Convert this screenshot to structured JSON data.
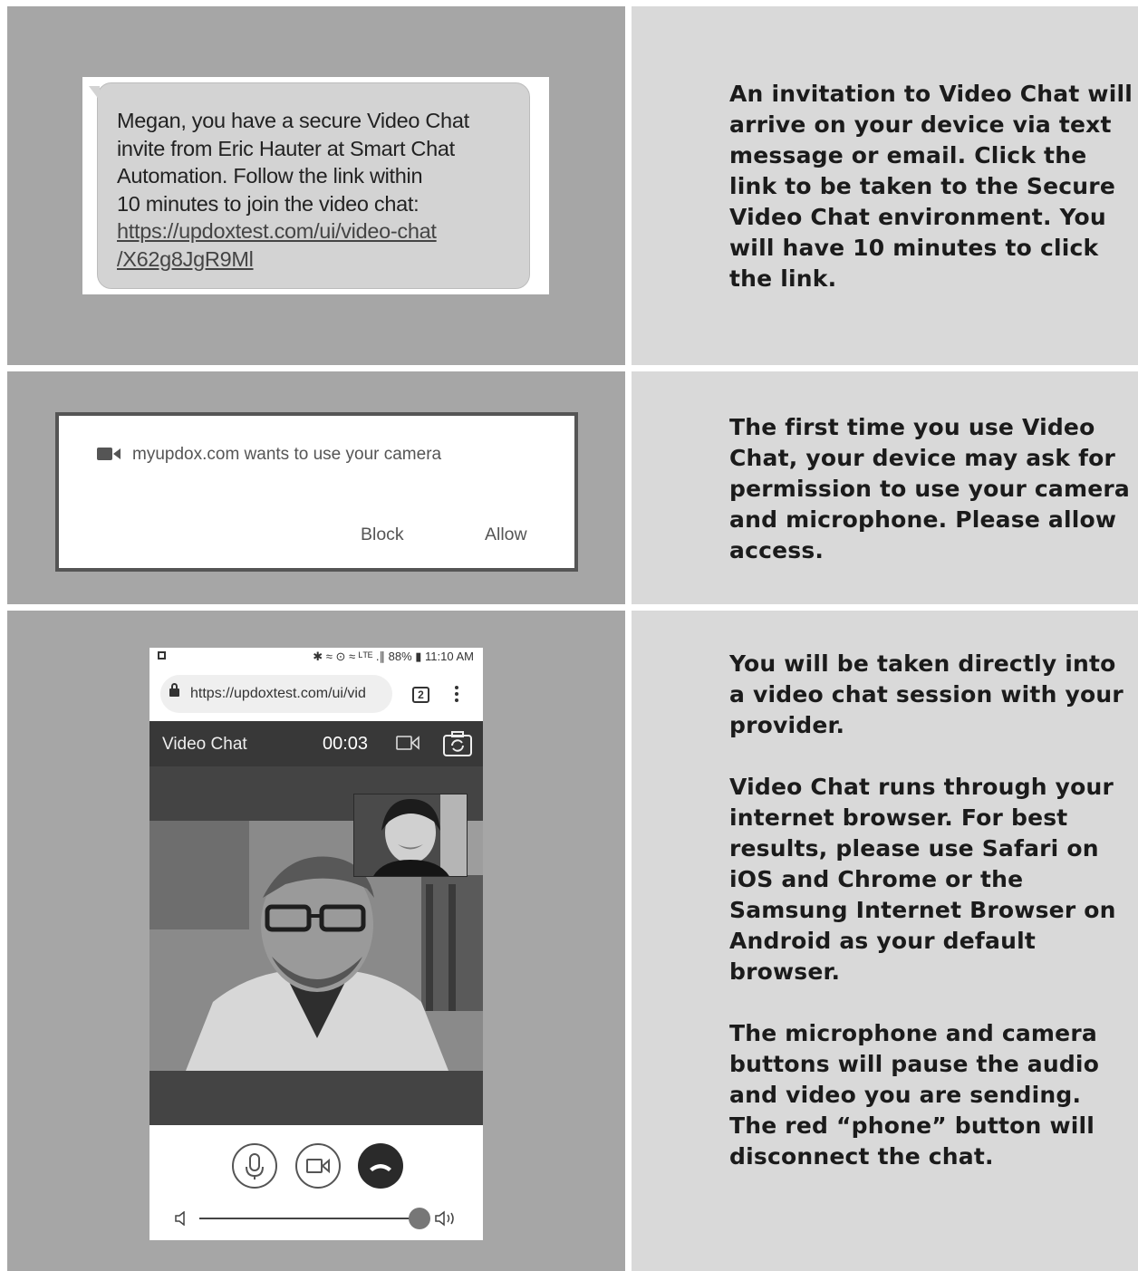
{
  "sms": {
    "line1": "Megan, you have a secure Video Chat",
    "line2": "invite from Eric Hauter at Smart Chat",
    "line3": "Automation. Follow the link within",
    "line4": "10 minutes to join the video chat:",
    "link1": "https://updoxtest.com/ui/video-chat",
    "link2": "/X62g8JgR9Ml"
  },
  "permission": {
    "icon": "video-camera-icon",
    "message": "myupdox.com wants to use your camera",
    "block_label": "Block",
    "allow_label": "Allow"
  },
  "phone": {
    "status_right": "✱ ≈ ⊙ ≈ ᴸᵀᴱ .∥ 88% ▮ 11:10 AM",
    "url": "https://updoxtest.com/ui/vid",
    "tab_count": "2",
    "title": "Video Chat",
    "timer": "00:03"
  },
  "descriptions": {
    "step1": "An invitation to Video Chat will arrive on your device via text message or email. Click the link to be taken to the Secure Video Chat environment. You will have 10 minutes to click the link.",
    "step2": "The first time you use Video Chat, your device may ask for permission to use your camera and microphone. Please allow access.",
    "step3a": "You will be taken directly into a video chat session with your provider.",
    "step3b": "Video Chat runs through your internet browser. For best results, please use Safari on iOS and Chrome or the Samsung Internet Browser on Android as your default browser.",
    "step3c": "The microphone and camera buttons will pause the audio and video you are sending. The red “phone” button will disconnect the chat."
  },
  "colors": {
    "left_panel": "#a6a6a6",
    "right_panel": "#d9d9d9",
    "text": "#1b1b1b"
  }
}
